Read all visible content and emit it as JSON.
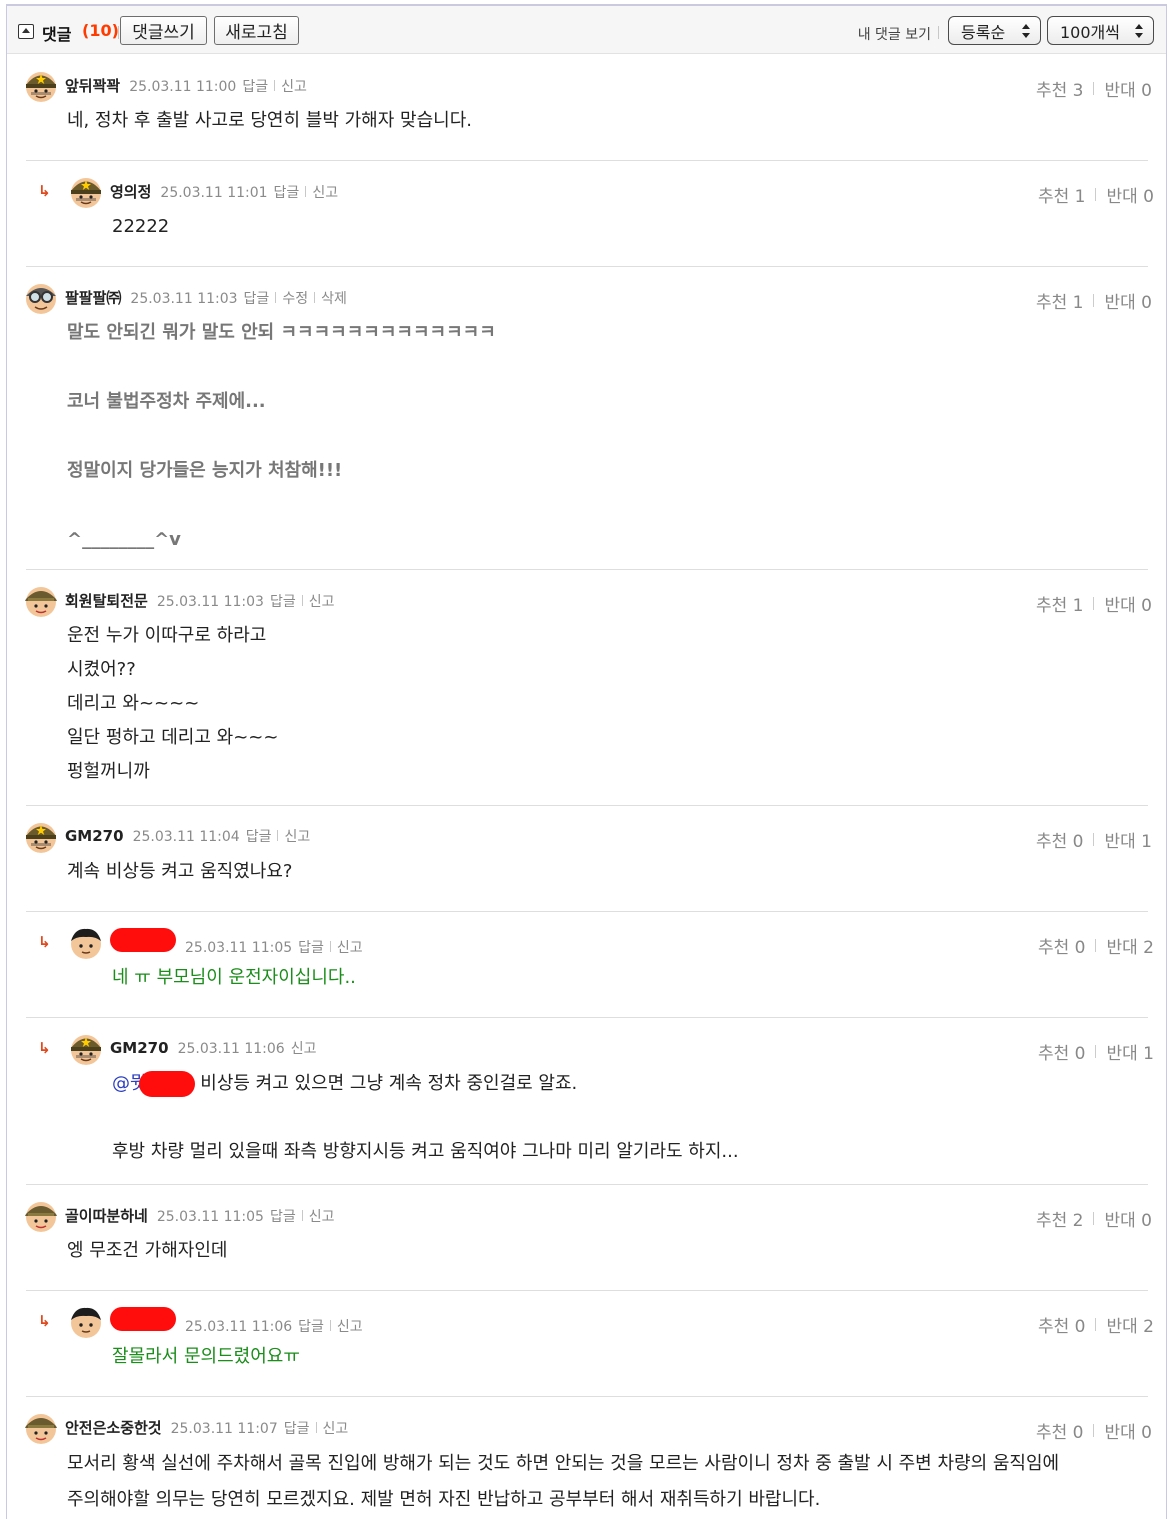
{
  "toolbar": {
    "title": "댓글",
    "count": "(10)",
    "write_label": "댓글쓰기",
    "refresh_label": "새로고침",
    "my_comments_label": "내 댓글 보기",
    "sort_value": "등록순",
    "page_size_value": "100개씩"
  },
  "labels": {
    "reply": "답글",
    "report": "신고",
    "edit": "수정",
    "delete": "삭제",
    "up": "추천",
    "down": "반대",
    "reply_arrow": "↳"
  },
  "comments": [
    {
      "nick": "앞뒤꽉꽉",
      "date": "25.03.11 11:00",
      "up": "3",
      "down": "0",
      "text": "네, 정차 후 출발 사고로 당연히 블박 가해자 맞습니다."
    },
    {
      "nick": "영의정",
      "date": "25.03.11 11:01",
      "up": "1",
      "down": "0",
      "text": "22222"
    },
    {
      "nick": "팔팔팔㈜",
      "date": "25.03.11 11:03",
      "up": "1",
      "down": "0",
      "text": "말도 안되긴 뭐가 말도 안되 ㅋㅋㅋㅋㅋㅋㅋㅋㅋㅋㅋㅋㅋ\n\n코너 불법주정차 주제에...\n\n정말이지 당가들은 능지가 처참해!!!\n\n^________^v"
    },
    {
      "nick": "회원탈퇴전문",
      "date": "25.03.11 11:03",
      "up": "1",
      "down": "0",
      "text": "운전 누가 이따구로 하라고\n시켰어??\n데리고 와~~~~\n일단 펑하고 데리고 와~~~\n펑헐꺼니까"
    },
    {
      "nick": "GM270",
      "date": "25.03.11 11:04",
      "up": "0",
      "down": "1",
      "text": "계속 비상등 켜고 움직였나요?"
    },
    {
      "nick": "",
      "date": "25.03.11 11:05",
      "up": "0",
      "down": "2",
      "text": "네 ㅠ 부모님이 운전자이십니다.."
    },
    {
      "nick": "GM270",
      "date": "25.03.11 11:06",
      "up": "0",
      "down": "1",
      "mention": "@뭣",
      "text": " 비상등 켜고 있으면 그냥 계속 정차 중인걸로 알죠.",
      "text2": "후방 차량 멀리 있을때 좌측 방향지시등 켜고 움직여야 그나마 미리 알기라도 하지..."
    },
    {
      "nick": "골이따분하네",
      "date": "25.03.11 11:05",
      "up": "2",
      "down": "0",
      "text": "엥 무조건 가해자인데"
    },
    {
      "nick": "",
      "date": "25.03.11 11:06",
      "up": "0",
      "down": "2",
      "text": "잘몰라서 문의드렸어요ㅠ"
    },
    {
      "nick": "안전은소중한것",
      "date": "25.03.11 11:07",
      "up": "0",
      "down": "0",
      "text": "모서리 황색 실선에 주차해서 골목 진입에 방해가 되는 것도 하면 안되는 것을 모르는 사람이니 정차 중 출발 시 주변 차량의 움직임에\n주의해야할 의무는 당연히 모르겠지요. 제발 면허 자진 반납하고 공부부터 해서 재취득하기 바랍니다."
    }
  ],
  "colors": {
    "accent_count": "#ff3b00",
    "reply_arrow": "#e0491d",
    "green_text": "#1a8d1a",
    "mention": "#2c3ec2",
    "redaction": "#ff0d0d"
  }
}
